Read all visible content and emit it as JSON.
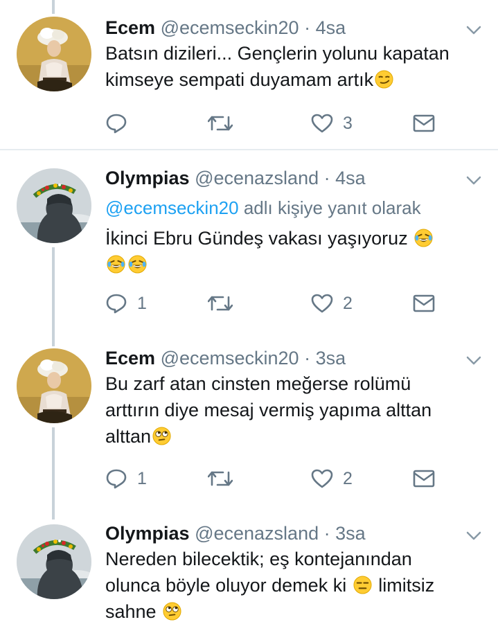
{
  "tweets": [
    {
      "name": "Ecem",
      "handle": "@ecemseckin20",
      "dot": "·",
      "time": "4sa",
      "body": "Batsın dizileri... Gençlerin yolunu kapatan kimseye sempati duyamam artık",
      "emojis": [
        "smirking-face"
      ],
      "reply_count": "",
      "like_count": "3"
    },
    {
      "name": "Olympias",
      "handle": "@ecenazsland",
      "dot": "·",
      "time": "4sa",
      "replying_mention": "@ecemseckin20",
      "replying_suffix": "adlı kişiye yanıt olarak",
      "body": "İkinci Ebru Gündeş vakası yaşıyoruz",
      "emojis": [
        "tears-of-joy-face",
        "tears-of-joy-face",
        "tears-of-joy-face"
      ],
      "reply_count": "1",
      "like_count": "2"
    },
    {
      "name": "Ecem",
      "handle": "@ecemseckin20",
      "dot": "·",
      "time": "3sa",
      "body_line1": "Bu zarf atan cinsten meğerse rolümü",
      "body_line2": "arttırın diye mesaj vermiş yapıma alttan",
      "body_line3": "alttan",
      "emojis": [
        "rolling-eyes-face"
      ],
      "reply_count": "1",
      "like_count": "2"
    },
    {
      "name": "Olympias",
      "handle": "@ecenazsland",
      "dot": "·",
      "time": "3sa",
      "body_line1": "Nereden bilecektik; eş kontejanından",
      "body_line2a": "olunca böyle oluyor demek ki",
      "body_line2b": "limitsiz",
      "body_line3": "sahne",
      "emojis": [
        "expressionless-face",
        "rolling-eyes-face"
      ]
    }
  ],
  "icons": {
    "reply": "reply-icon",
    "retweet": "retweet-icon",
    "like": "heart-icon",
    "message": "envelope-icon",
    "caret": "chevron-down-icon"
  },
  "colors": {
    "text": "#14171a",
    "muted": "#657786",
    "link": "#1da1f2",
    "thread_line": "#c8d2d9",
    "separator": "#e6ecf0",
    "emoji_yellow": "#ffcc33"
  }
}
